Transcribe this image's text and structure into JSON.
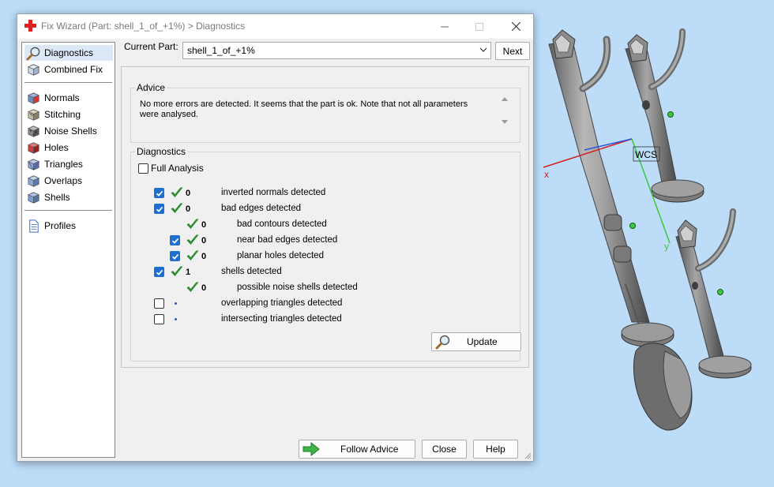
{
  "window": {
    "title": "Fix Wizard (Part: shell_1_of_+1%) > Diagnostics"
  },
  "nav": {
    "groups": [
      [
        {
          "label": "Diagnostics",
          "icon": "magnifier-icon",
          "selected": true
        },
        {
          "label": "Combined Fix",
          "icon": "cube-icon",
          "selected": false
        }
      ],
      [
        {
          "label": "Normals",
          "icon": "normals-cube-icon",
          "selected": false
        },
        {
          "label": "Stitching",
          "icon": "stitching-cube-icon",
          "selected": false
        },
        {
          "label": "Noise Shells",
          "icon": "noise-shells-icon",
          "selected": false
        },
        {
          "label": "Holes",
          "icon": "holes-cube-icon",
          "selected": false
        },
        {
          "label": "Triangles",
          "icon": "triangles-cube-icon",
          "selected": false
        },
        {
          "label": "Overlaps",
          "icon": "overlaps-cube-icon",
          "selected": false
        },
        {
          "label": "Shells",
          "icon": "shells-cube-icon",
          "selected": false
        }
      ],
      [
        {
          "label": "Profiles",
          "icon": "document-icon",
          "selected": false
        }
      ]
    ]
  },
  "current_part": {
    "label": "Current Part:",
    "value": "shell_1_of_+1%",
    "next_label": "Next"
  },
  "advice": {
    "title": "Advice",
    "text": "No more errors are detected. It seems that the part is ok. Note that not all parameters were analysed."
  },
  "diagnostics": {
    "title": "Diagnostics",
    "full_analysis_label": "Full Analysis",
    "full_analysis_checked": false,
    "rows": [
      {
        "checkbox": true,
        "checked": true,
        "status": "ok",
        "count": "0",
        "label": "inverted normals detected",
        "indent": 0
      },
      {
        "checkbox": true,
        "checked": true,
        "status": "ok",
        "count": "0",
        "label": "bad edges detected",
        "indent": 0
      },
      {
        "checkbox": false,
        "checked": false,
        "status": "ok",
        "count": "0",
        "label": "bad contours detected",
        "indent": 1
      },
      {
        "checkbox": true,
        "checked": true,
        "status": "ok",
        "count": "0",
        "label": "near bad edges detected",
        "indent": 1
      },
      {
        "checkbox": true,
        "checked": true,
        "status": "ok",
        "count": "0",
        "label": "planar holes detected",
        "indent": 1
      },
      {
        "checkbox": true,
        "checked": true,
        "status": "ok",
        "count": "1",
        "label": "shells detected",
        "indent": 0
      },
      {
        "checkbox": false,
        "checked": false,
        "status": "ok",
        "count": "0",
        "label": "possible noise shells detected",
        "indent": 1
      },
      {
        "checkbox": true,
        "checked": false,
        "status": "pending",
        "count": "",
        "label": "overlapping triangles detected",
        "indent": 0
      },
      {
        "checkbox": true,
        "checked": false,
        "status": "pending",
        "count": "",
        "label": "intersecting triangles detected",
        "indent": 0
      }
    ],
    "update_label": "Update"
  },
  "footer": {
    "follow_label": "Follow Advice",
    "close_label": "Close",
    "help_label": "Help"
  },
  "viewport": {
    "wcs_label": "WCS",
    "axis_x": "x",
    "axis_y": "y"
  },
  "colors": {
    "check_green": "#2e8b2e",
    "checkbox_blue": "#1e6fd2",
    "pending_dot": "#2b55b8",
    "axis_x": "#d21f1f",
    "axis_y": "#3cc83c",
    "axis_z": "#2b55d8"
  }
}
